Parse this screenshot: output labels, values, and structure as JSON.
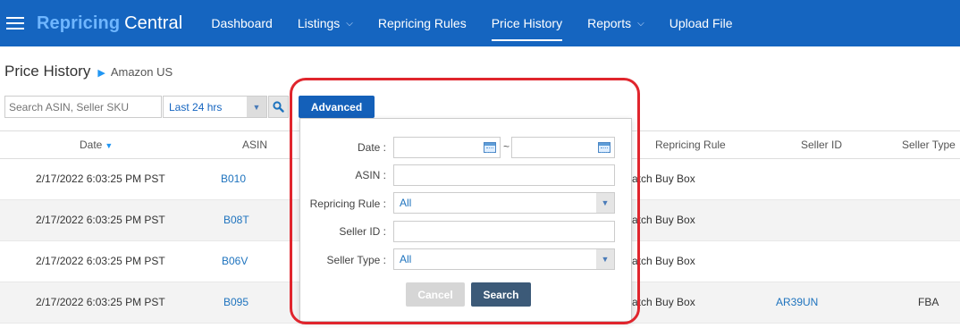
{
  "brand": {
    "part1": "Repricing",
    "part2": "Central"
  },
  "nav": [
    {
      "label": "Dashboard",
      "chevron": false,
      "active": false
    },
    {
      "label": "Listings",
      "chevron": true,
      "active": false
    },
    {
      "label": "Repricing Rules",
      "chevron": false,
      "active": false
    },
    {
      "label": "Price History",
      "chevron": false,
      "active": true
    },
    {
      "label": "Reports",
      "chevron": true,
      "active": false
    },
    {
      "label": "Upload File",
      "chevron": false,
      "active": false
    }
  ],
  "page": {
    "title": "Price History",
    "marketplace": "Amazon US"
  },
  "filters": {
    "search_placeholder": "Search ASIN, Seller SKU",
    "range_value": "Last 24 hrs",
    "advanced_label": "Advanced"
  },
  "table": {
    "headers": {
      "date": "Date",
      "asin": "ASIN",
      "rule": "Repricing Rule",
      "seller_id": "Seller ID",
      "seller_type": "Seller Type"
    },
    "rows": [
      {
        "date": "2/17/2022 6:03:25 PM PST",
        "asin": "B010",
        "rule": "atch Buy Box",
        "seller_id": "",
        "seller_type": ""
      },
      {
        "date": "2/17/2022 6:03:25 PM PST",
        "asin": "B08T",
        "rule": "atch Buy Box",
        "seller_id": "",
        "seller_type": ""
      },
      {
        "date": "2/17/2022 6:03:25 PM PST",
        "asin": "B06V",
        "rule": "atch Buy Box",
        "seller_id": "",
        "seller_type": ""
      },
      {
        "date": "2/17/2022 6:03:25 PM PST",
        "asin": "B095",
        "rule": "atch Buy Box",
        "seller_id": "AR39UN",
        "seller_type": "FBA"
      }
    ]
  },
  "advanced_panel": {
    "date_label": "Date :",
    "date_separator": "~",
    "asin_label": "ASIN :",
    "rule_label": "Repricing Rule :",
    "rule_value": "All",
    "seller_id_label": "Seller ID :",
    "seller_type_label": "Seller Type :",
    "seller_type_value": "All",
    "cancel_label": "Cancel",
    "search_label": "Search"
  },
  "colors": {
    "navbar": "#1565c0",
    "brand_light": "#6fb6ff",
    "highlight": "#e0252d",
    "link": "#1e73be"
  }
}
